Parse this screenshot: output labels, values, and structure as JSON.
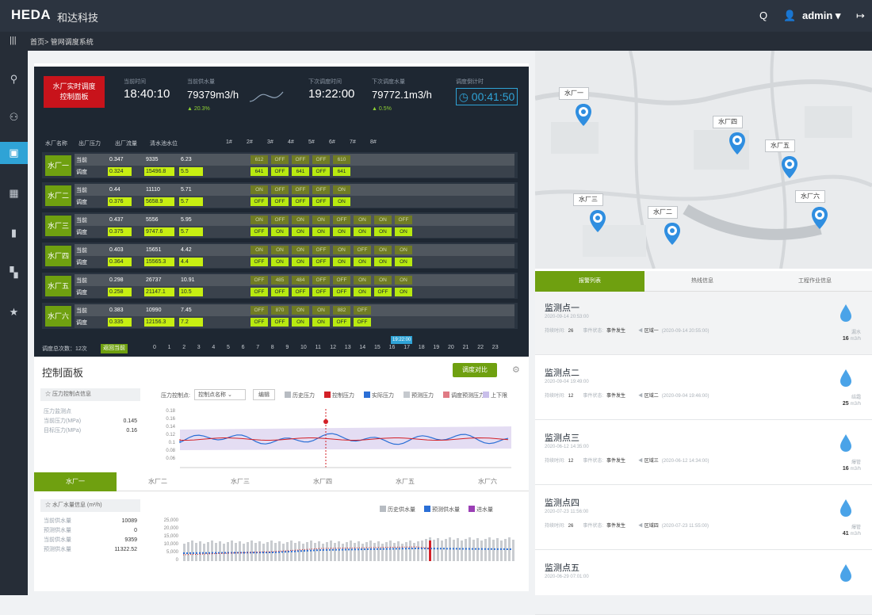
{
  "app": {
    "logo": "HEDA",
    "company": "和达科技",
    "user": "admin",
    "breadcrumb": "首页> 管网调度系统"
  },
  "header": {
    "button_line1": "水厂实时调度",
    "button_line2": "控制面板",
    "current_time_label": "当前时间",
    "current_time": "18:40:10",
    "supply_label": "当前供水量",
    "supply": "79379m3/h",
    "supply_pct": "▲ 20.3%",
    "next_time_label": "下次调度时间",
    "next_time": "19:22:00",
    "next_supply_label": "下次调度水量",
    "next_supply": "79772.1m3/h",
    "next_pct": "▲ 0.5%",
    "countdown_label": "调度倒计时",
    "countdown": "◷ 00:41:50"
  },
  "table": {
    "headers": [
      "水厂名称",
      "出厂压力",
      "出厂流量",
      "清水池水位",
      "1#",
      "2#",
      "3#",
      "4#",
      "5#",
      "6#",
      "7#",
      "8#"
    ],
    "row_label_current": "当前",
    "row_label_plan": "调度",
    "plants": [
      {
        "name": "水厂一",
        "cur": [
          "0.347",
          "9335",
          "6.23"
        ],
        "plan": [
          "0.324",
          "15496.8",
          "5.5"
        ],
        "cur_pumps": [
          "612",
          "OFF",
          "OFF",
          "OFF",
          "610",
          "",
          "",
          ""
        ],
        "plan_pumps": [
          "641",
          "OFF",
          "641",
          "OFF",
          "641",
          "",
          "",
          ""
        ]
      },
      {
        "name": "水厂二",
        "cur": [
          "0.44",
          "11110",
          "5.71"
        ],
        "plan": [
          "0.376",
          "5658.9",
          "5.7"
        ],
        "cur_pumps": [
          "ON",
          "OFF",
          "OFF",
          "OFF",
          "ON",
          "",
          "",
          ""
        ],
        "plan_pumps": [
          "OFF",
          "OFF",
          "OFF",
          "OFF",
          "ON",
          "",
          "",
          ""
        ]
      },
      {
        "name": "水厂三",
        "cur": [
          "0.437",
          "5556",
          "5.95"
        ],
        "plan": [
          "0.375",
          "9747.6",
          "5.7"
        ],
        "cur_pumps": [
          "ON",
          "OFF",
          "ON",
          "ON",
          "OFF",
          "ON",
          "ON",
          "OFF"
        ],
        "plan_pumps": [
          "OFF",
          "ON",
          "ON",
          "ON",
          "ON",
          "ON",
          "ON",
          "ON"
        ]
      },
      {
        "name": "水厂四",
        "cur": [
          "0.403",
          "15651",
          "4.42"
        ],
        "plan": [
          "0.364",
          "15565.3",
          "4.4"
        ],
        "cur_pumps": [
          "ON",
          "ON",
          "ON",
          "OFF",
          "ON",
          "OFF",
          "ON",
          "ON"
        ],
        "plan_pumps": [
          "OFF",
          "ON",
          "ON",
          "OFF",
          "ON",
          "ON",
          "ON",
          "ON"
        ]
      },
      {
        "name": "水厂五",
        "cur": [
          "0.298",
          "26737",
          "10.91"
        ],
        "plan": [
          "0.258",
          "21147.1",
          "10.5"
        ],
        "cur_pumps": [
          "OFF",
          "485",
          "484",
          "OFF",
          "OFF",
          "ON",
          "ON",
          "ON"
        ],
        "plan_pumps": [
          "OFF",
          "OFF",
          "OFF",
          "OFF",
          "OFF",
          "ON",
          "OFF",
          "ON"
        ]
      },
      {
        "name": "水厂六",
        "cur": [
          "0.383",
          "10990",
          "7.45"
        ],
        "plan": [
          "0.335",
          "12156.3",
          "7.2"
        ],
        "cur_pumps": [
          "OFF",
          "870",
          "ON",
          "ON",
          "882",
          "OFF",
          "",
          ""
        ],
        "plan_pumps": [
          "OFF",
          "OFF",
          "ON",
          "ON",
          "OFF",
          "OFF",
          "",
          ""
        ]
      }
    ]
  },
  "timeline": {
    "count_label": "调度总次数：12次",
    "back_button": "返回当前",
    "ticks": [
      "0",
      "1",
      "2",
      "3",
      "4",
      "5",
      "6",
      "7",
      "8",
      "9",
      "10",
      "11",
      "12",
      "13",
      "14",
      "15",
      "16",
      "17",
      "18",
      "19",
      "20",
      "21",
      "22",
      "23"
    ],
    "marker": "19:22:00"
  },
  "control": {
    "title": "控制面板",
    "compare_button": "调度对比",
    "pressure_box_title": "☆ 压力控制点信息",
    "pressure_point_label": "压力监测点",
    "current_pressure_label": "当前压力(MPa)",
    "current_pressure": "0.145",
    "target_pressure_label": "目标压力(MPa)",
    "target_pressure": "0.16",
    "control_point_label": "压力控制点:",
    "control_point_select": "控制点名称",
    "edit_button": "编辑",
    "pressure_legend": [
      "历史压力",
      "控制压力",
      "实际压力",
      "预测压力",
      "调度预测压力",
      "上下限"
    ],
    "pressure_ticks": [
      "0.18",
      "0.16",
      "0.14",
      "0.12",
      "0.1",
      "0.08",
      "0.06"
    ],
    "tabs": [
      "水厂一",
      "水厂二",
      "水厂三",
      "水厂四",
      "水厂五",
      "水厂六"
    ],
    "water_box_title": "☆ 水厂水量信息 (m³/h)",
    "water_rows": [
      {
        "label": "当前供水量",
        "value": "10089"
      },
      {
        "label": "预测供水量",
        "value": "0"
      },
      {
        "label": "当前供水量",
        "value": "9359"
      },
      {
        "label": "预测供水量",
        "value": "11322.52"
      }
    ],
    "water_legend": [
      "历史供水量",
      "预测供水量",
      "进水量"
    ],
    "water_ticks": [
      "25,000",
      "20,000",
      "15,000",
      "10,000",
      "5,000",
      "0"
    ]
  },
  "map": {
    "labels": [
      "水厂一",
      "水厂四",
      "水厂五",
      "水厂三",
      "水厂二",
      "水厂六"
    ]
  },
  "right_tabs": [
    "报警列表",
    "热线信息",
    "工程作业信息"
  ],
  "alerts": [
    {
      "title": "监测点一",
      "date": "2020-09-14 20:53:00",
      "times_label": "持续时间:",
      "times": "26",
      "status_label": "事件状态:",
      "status": "事件发生",
      "zone": "区域一",
      "zone_time": "(2020-09-14 20:55:00)",
      "type": "漏水",
      "flow": "16",
      "unit": "m3/h"
    },
    {
      "title": "监测点二",
      "date": "2020-09-04 19:49:00",
      "times_label": "持续时间:",
      "times": "12",
      "status_label": "事件状态:",
      "status": "事件发生",
      "zone": "区域二",
      "zone_time": "(2020-09-04 19:46:00)",
      "type": "结霜",
      "flow": "25",
      "unit": "m3/h"
    },
    {
      "title": "监测点三",
      "date": "2020-06-12 14:35:00",
      "times_label": "持续时间:",
      "times": "12",
      "status_label": "事件状态:",
      "status": "事件发生",
      "zone": "区域三",
      "zone_time": "(2020-06-12 14:34:00)",
      "type": "爆管",
      "flow": "16",
      "unit": "m3/h"
    },
    {
      "title": "监测点四",
      "date": "2020-07-23 11:56:00",
      "times_label": "持续时间:",
      "times": "26",
      "status_label": "事件状态:",
      "status": "事件发生",
      "zone": "区域四",
      "zone_time": "(2020-07-23 11:55:00)",
      "type": "爆管",
      "flow": "41",
      "unit": "m3/h"
    },
    {
      "title": "监测点五",
      "date": "2020-06-29 07:01:00"
    }
  ]
}
